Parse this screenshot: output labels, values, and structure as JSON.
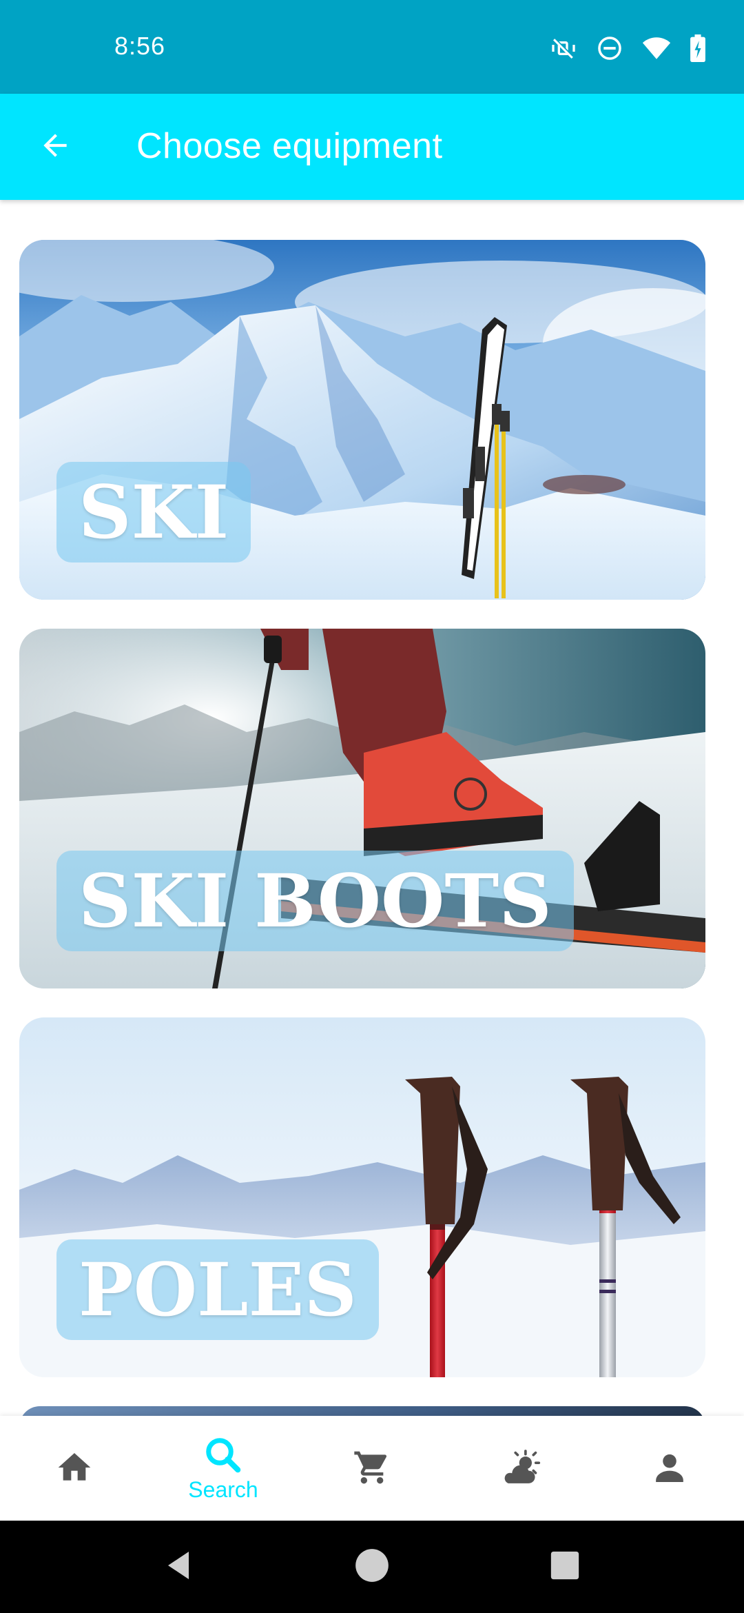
{
  "status_bar": {
    "time": "8:56",
    "icons": [
      "vibrate-off-icon",
      "do-not-disturb-icon",
      "wifi-icon",
      "battery-charging-icon"
    ]
  },
  "app_bar": {
    "title": "Choose equipment",
    "back_icon": "arrow-back-icon"
  },
  "categories": [
    {
      "label": "SKI",
      "image": "snowy-mountain-with-skis-photo"
    },
    {
      "label": "SKI BOOTS",
      "image": "ski-boot-touring-photo"
    },
    {
      "label": "POLES",
      "image": "ski-poles-mountains-photo"
    }
  ],
  "bottom_nav": {
    "items": [
      {
        "icon": "home-icon",
        "label": ""
      },
      {
        "icon": "search-icon",
        "label": "Search",
        "active": true
      },
      {
        "icon": "cart-icon",
        "label": ""
      },
      {
        "icon": "weather-icon",
        "label": ""
      },
      {
        "icon": "profile-icon",
        "label": ""
      }
    ]
  },
  "colors": {
    "status_bar": "#00A3C4",
    "app_bar": "#00E5FF",
    "accent": "#00E5FF",
    "icon_inactive": "#555555"
  }
}
